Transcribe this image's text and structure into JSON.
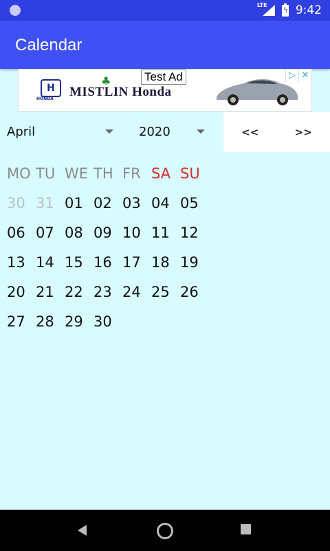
{
  "status_bar": {
    "network": "LTE",
    "time": "9:42"
  },
  "app_bar": {
    "title": "Calendar"
  },
  "ad": {
    "label": "Test Ad",
    "brand": "MISTLIN Honda",
    "logo_text": "H",
    "logo_caption": "HONDA"
  },
  "controls": {
    "month": "April",
    "year": "2020",
    "prev_label": "<<",
    "next_label": ">>"
  },
  "calendar": {
    "weekdays": [
      "MO",
      "TU",
      "WE",
      "TH",
      "FR",
      "SA",
      "SU"
    ],
    "weeks": [
      [
        "30",
        "31",
        "01",
        "02",
        "03",
        "04",
        "05"
      ],
      [
        "06",
        "07",
        "08",
        "09",
        "10",
        "11",
        "12"
      ],
      [
        "13",
        "14",
        "15",
        "16",
        "17",
        "18",
        "19"
      ],
      [
        "20",
        "21",
        "22",
        "23",
        "24",
        "25",
        "26"
      ],
      [
        "27",
        "28",
        "29",
        "30",
        "",
        "",
        ""
      ]
    ]
  },
  "colors": {
    "status_bar": "#303fe0",
    "app_bar": "#3f51f5",
    "background": "#d7fbfe",
    "weekend": "#d32f2f"
  }
}
